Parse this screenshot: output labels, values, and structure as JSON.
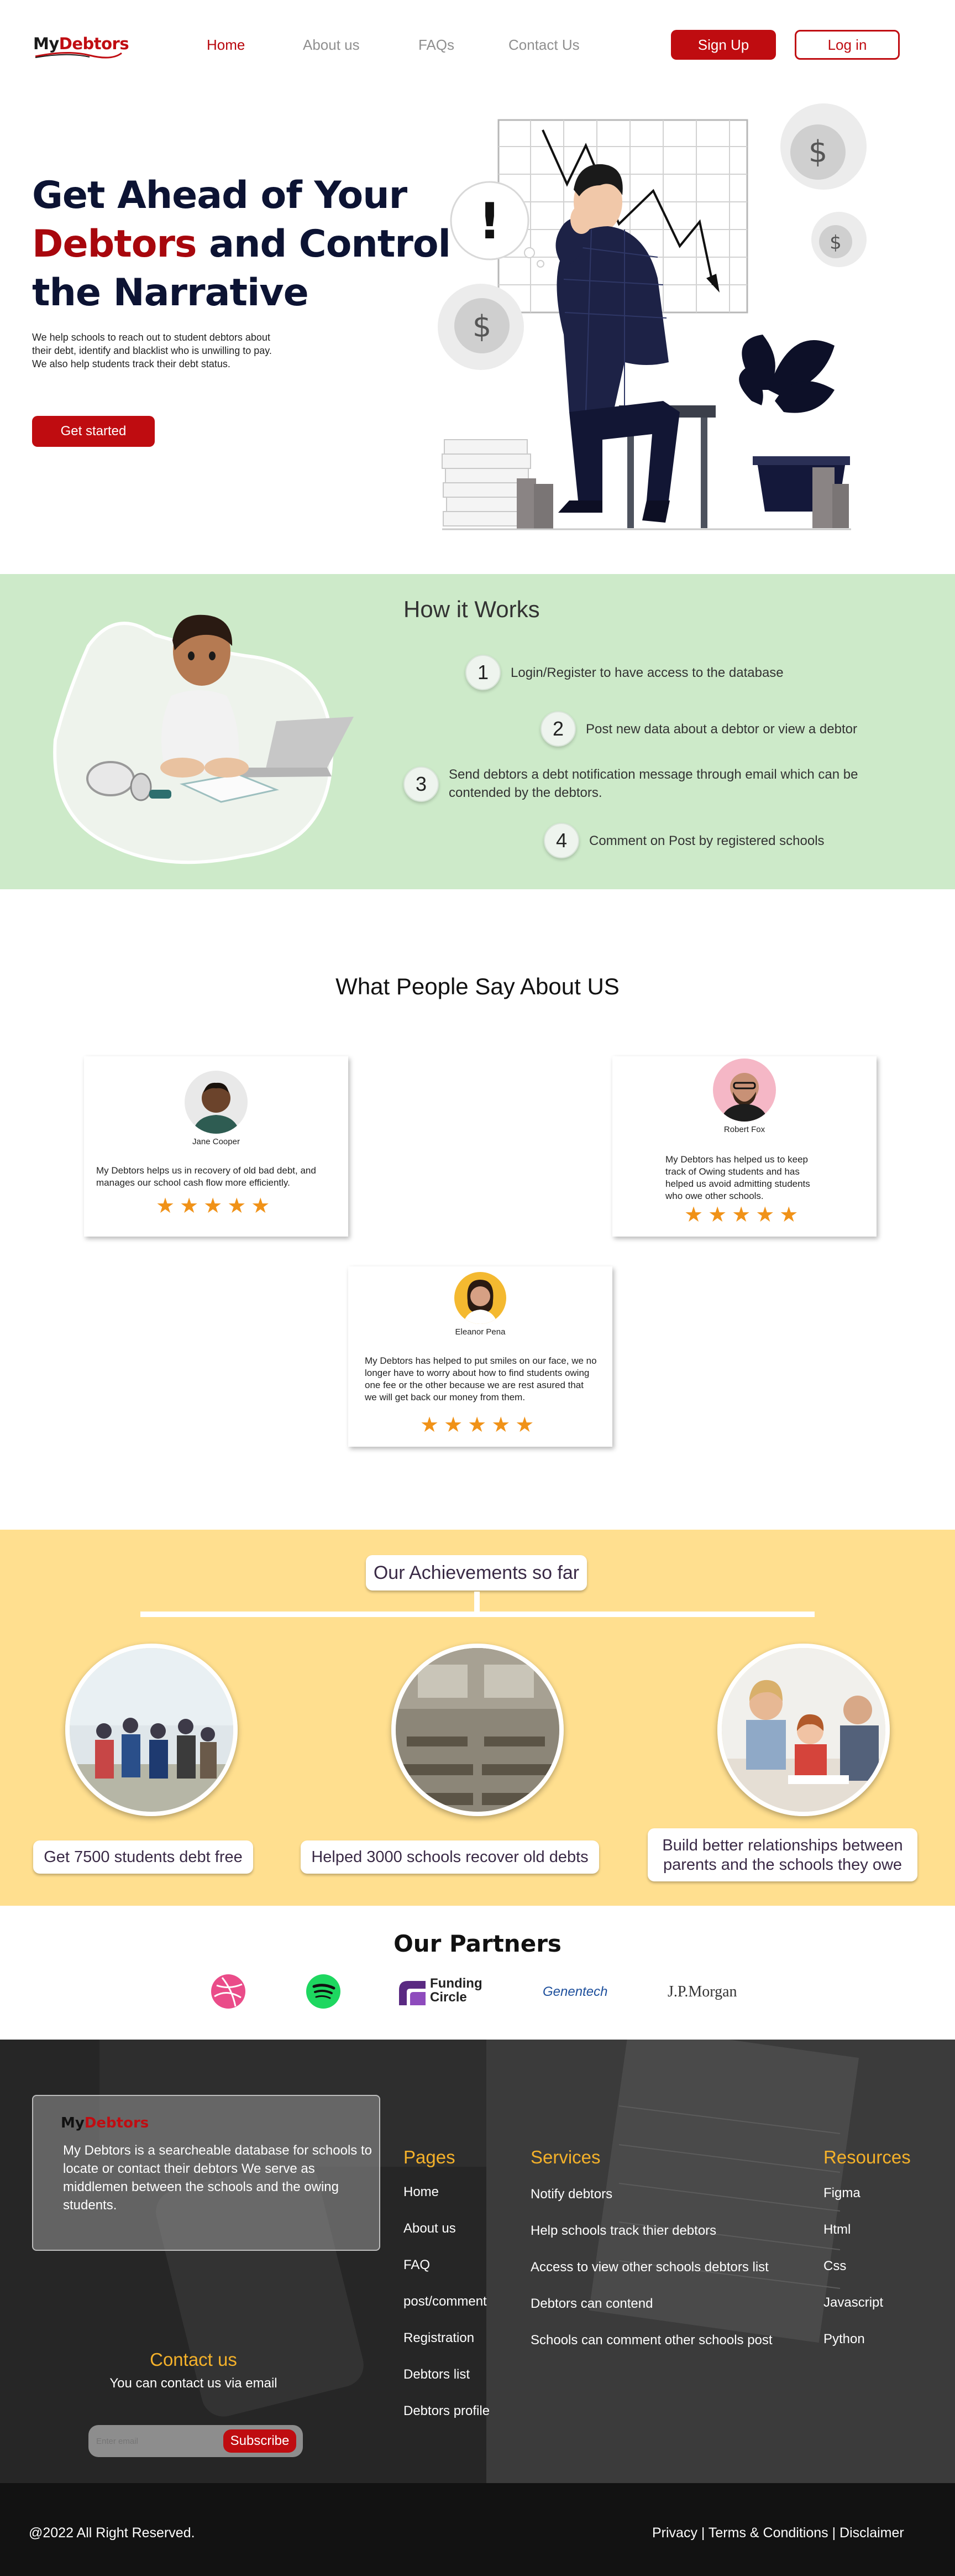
{
  "brand": {
    "logo_part1": "My",
    "logo_part2": "Debtors"
  },
  "nav": {
    "links": [
      "Home",
      "About us",
      "FAQs",
      "Contact Us"
    ],
    "signup": "Sign Up",
    "login": "Log in"
  },
  "hero": {
    "title_line1": "Get Ahead of Your",
    "title_red": "Debtors",
    "title_line2_rest": " and Control",
    "title_line3": "the Narrative",
    "description": "We help schools to reach out to student debtors about  their debt, identify and blacklist who is unwilling to pay. We also help students track their debt status.",
    "cta": "Get started"
  },
  "how": {
    "title": "How it Works",
    "steps": [
      {
        "num": "1",
        "text": "Login/Register to have access to the database"
      },
      {
        "num": "2",
        "text": "Post new data about a debtor or view a debtor"
      },
      {
        "num": "3",
        "text": "Send debtors a debt notification message through email which can be contended by the debtors."
      },
      {
        "num": "4",
        "text": "Comment on Post by registered schools"
      }
    ]
  },
  "testimonials": {
    "title": "What People Say About US",
    "items": [
      {
        "name": "Jane Cooper",
        "quote": "My Debtors helps us in recovery of old bad debt, and manages our school cash flow more efficiently.",
        "stars": "★★★★★"
      },
      {
        "name": "Robert Fox",
        "quote": "My Debtors has helped us to keep track of Owing students and has helped us avoid admitting students who owe other schools.",
        "stars": "★★★★★"
      },
      {
        "name": "Eleanor Pena",
        "quote": "My Debtors has helped to put smiles on our face, we no longer have to worry about how to find students owing one fee or the other because we are rest asured that we will get back our money from them.",
        "stars": "★★★★★"
      }
    ]
  },
  "achievements": {
    "title": "Our Achievements so far",
    "items": [
      {
        "caption": "Get 7500 students debt free"
      },
      {
        "caption": "Helped 3000 schools recover old debts"
      },
      {
        "caption": "Build better relationships between parents and the schools they owe"
      }
    ]
  },
  "partners": {
    "title": "Our Partners",
    "logos": [
      "dribbble-icon",
      "spotify-icon",
      "Funding Circle",
      "Genentech",
      "J.P.Morgan"
    ],
    "funding_line1": "Funding",
    "funding_line2": "Circle",
    "genentech": "Genentech",
    "jpmorgan": "J.P.Morgan"
  },
  "footer": {
    "about": "My Debtors is a searcheable database for schools to locate or contact their debtors We serve as middlemen between the schools and the owing students.",
    "contact_title": "Contact us",
    "contact_text": "You can contact us via email",
    "email_placeholder": "Enter email",
    "subscribe": "Subscribe",
    "pages_title": "Pages",
    "pages": [
      "Home",
      "About us",
      "FAQ",
      "post/comment",
      "Registration",
      "Debtors list",
      "Debtors profile"
    ],
    "services_title": "Services",
    "services": [
      "Notify debtors",
      "Help schools track thier debtors",
      "Access to view other schools debtors list",
      "Debtors can contend",
      "Schools can comment other schools post"
    ],
    "resources_title": "Resources",
    "resources": [
      "Figma",
      "Html",
      "Css",
      "Javascript",
      "Python"
    ],
    "copyright": "@2022 All Right Reserved.",
    "legal": "Privacy | Terms & Conditions | Disclaimer"
  },
  "colors": {
    "brand_red": "#bf0c10",
    "how_bg": "#cdeac9",
    "achievements_bg": "#ffdf8f",
    "footer_accent": "#f4b12a",
    "star": "#f09218"
  }
}
